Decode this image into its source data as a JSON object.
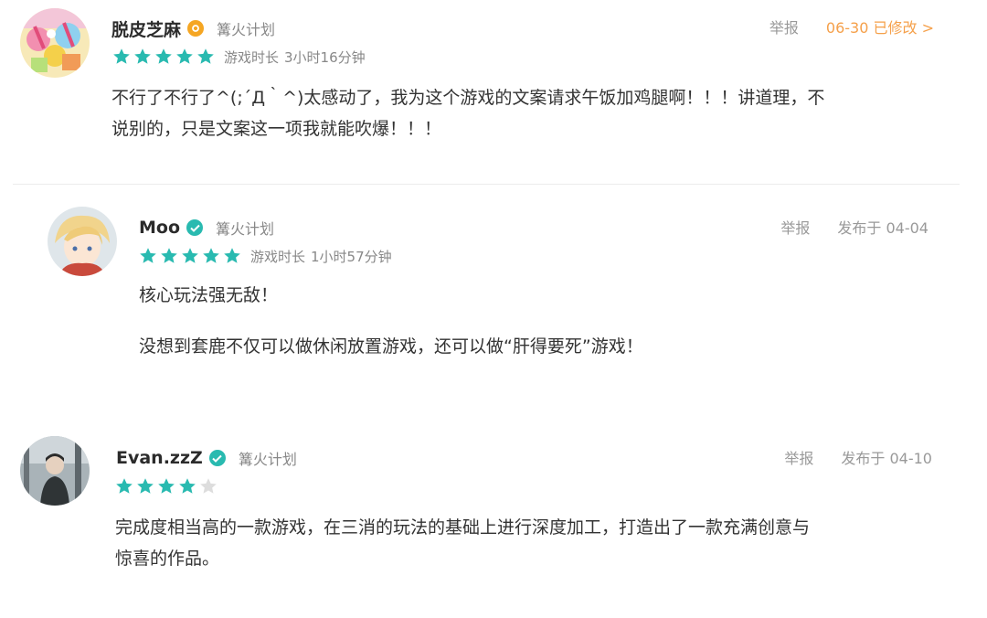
{
  "colors": {
    "star_filled": "#29bab0",
    "star_empty": "#dddddd",
    "verified_badge": "#29bab0",
    "official_badge": "#f5a623",
    "edited_date": "#f5a04a",
    "muted_text": "#888888"
  },
  "reviews": [
    {
      "username": "脱皮芝麻",
      "badge_icon": "official-badge-icon",
      "tag": "篝火计划",
      "rating": 5,
      "max_rating": 5,
      "playtime_label": "游戏时长",
      "playtime": "3小时16分钟",
      "report_label": "举报",
      "date": "06-30 已修改 >",
      "paragraphs": [
        "不行了不行了^(;´Д｀^)太感动了，我为这个游戏的文案请求午饭加鸡腿啊！！！讲道理，不",
        "说别的，只是文案这一项我就能吹爆！！！"
      ]
    },
    {
      "username": "Moo",
      "badge_icon": "verified-badge-icon",
      "tag": "篝火计划",
      "rating": 5,
      "max_rating": 5,
      "playtime_label": "游戏时长",
      "playtime": "1小时57分钟",
      "report_label": "举报",
      "date": "发布于 04-04",
      "paragraphs": [
        "核心玩法强无敌！",
        "没想到套鹿不仅可以做休闲放置游戏，还可以做“肝得要死”游戏！"
      ]
    },
    {
      "username": "Evan.zzZ",
      "badge_icon": "verified-badge-icon",
      "tag": "篝火计划",
      "rating": 4,
      "max_rating": 5,
      "report_label": "举报",
      "date": "发布于 04-10",
      "paragraphs": [
        "完成度相当高的一款游戏，在三消的玩法的基础上进行深度加工，打造出了一款充满创意与",
        "惊喜的作品。"
      ]
    }
  ]
}
